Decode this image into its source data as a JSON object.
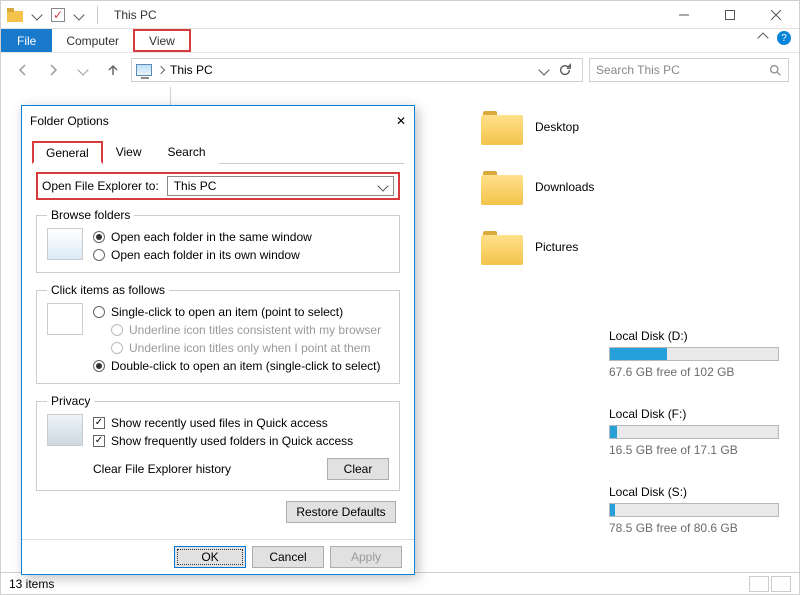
{
  "window": {
    "title": "This PC",
    "ribbon": {
      "file": "File",
      "computer": "Computer",
      "view": "View"
    },
    "address": {
      "location": "This PC"
    },
    "search": {
      "placeholder": "Search This PC"
    },
    "status": {
      "items": "13 items"
    },
    "folders": {
      "desktop": "Desktop",
      "downloads": "Downloads",
      "pictures": "Pictures"
    },
    "drives": [
      {
        "name": "Local Disk (D:)",
        "sub": "67.6 GB free of 102 GB",
        "fillPct": 34
      },
      {
        "name": "Local Disk (F:)",
        "sub": "16.5 GB free of 17.1 GB",
        "fillPct": 4
      },
      {
        "name": "Local Disk (S:)",
        "sub": "78.5 GB free of 80.6 GB",
        "fillPct": 3
      }
    ]
  },
  "dialog": {
    "title": "Folder Options",
    "tabs": {
      "general": "General",
      "view": "View",
      "search": "Search"
    },
    "open_to_label": "Open File Explorer to:",
    "open_to_value": "This PC",
    "browse": {
      "legend": "Browse folders",
      "same": "Open each folder in the same window",
      "own": "Open each folder in its own window"
    },
    "click": {
      "legend": "Click items as follows",
      "single": "Single-click to open an item (point to select)",
      "ul_browser": "Underline icon titles consistent with my browser",
      "ul_point": "Underline icon titles only when I point at them",
      "double": "Double-click to open an item (single-click to select)"
    },
    "privacy": {
      "legend": "Privacy",
      "recent_files": "Show recently used files in Quick access",
      "freq_folders": "Show frequently used folders in Quick access",
      "clear_label": "Clear File Explorer history",
      "clear_btn": "Clear"
    },
    "restore": "Restore Defaults",
    "buttons": {
      "ok": "OK",
      "cancel": "Cancel",
      "apply": "Apply"
    }
  }
}
